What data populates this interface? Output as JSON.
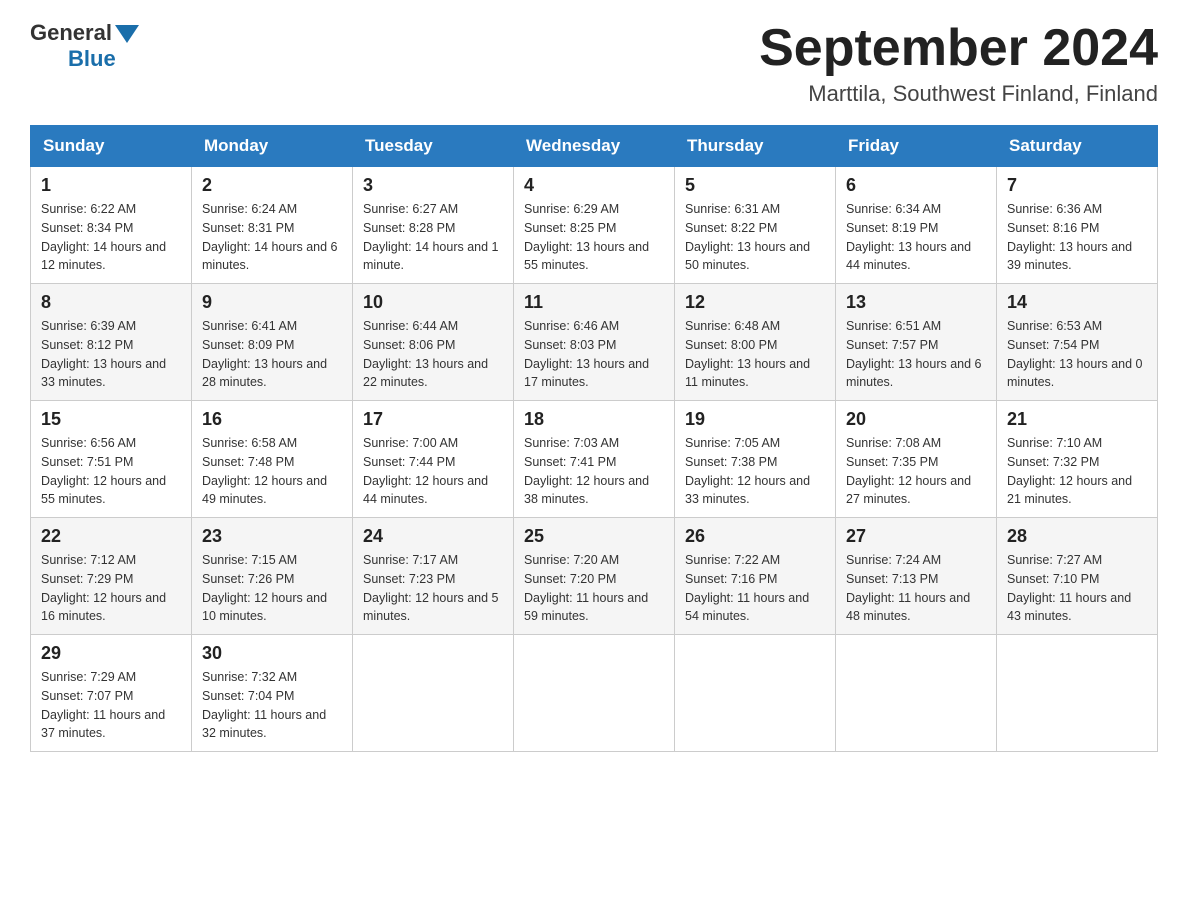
{
  "header": {
    "logo_general": "General",
    "logo_blue": "Blue",
    "month_year": "September 2024",
    "location": "Marttila, Southwest Finland, Finland"
  },
  "days_of_week": [
    "Sunday",
    "Monday",
    "Tuesday",
    "Wednesday",
    "Thursday",
    "Friday",
    "Saturday"
  ],
  "weeks": [
    [
      {
        "date": "1",
        "sunrise": "6:22 AM",
        "sunset": "8:34 PM",
        "daylight": "14 hours and 12 minutes."
      },
      {
        "date": "2",
        "sunrise": "6:24 AM",
        "sunset": "8:31 PM",
        "daylight": "14 hours and 6 minutes."
      },
      {
        "date": "3",
        "sunrise": "6:27 AM",
        "sunset": "8:28 PM",
        "daylight": "14 hours and 1 minute."
      },
      {
        "date": "4",
        "sunrise": "6:29 AM",
        "sunset": "8:25 PM",
        "daylight": "13 hours and 55 minutes."
      },
      {
        "date": "5",
        "sunrise": "6:31 AM",
        "sunset": "8:22 PM",
        "daylight": "13 hours and 50 minutes."
      },
      {
        "date": "6",
        "sunrise": "6:34 AM",
        "sunset": "8:19 PM",
        "daylight": "13 hours and 44 minutes."
      },
      {
        "date": "7",
        "sunrise": "6:36 AM",
        "sunset": "8:16 PM",
        "daylight": "13 hours and 39 minutes."
      }
    ],
    [
      {
        "date": "8",
        "sunrise": "6:39 AM",
        "sunset": "8:12 PM",
        "daylight": "13 hours and 33 minutes."
      },
      {
        "date": "9",
        "sunrise": "6:41 AM",
        "sunset": "8:09 PM",
        "daylight": "13 hours and 28 minutes."
      },
      {
        "date": "10",
        "sunrise": "6:44 AM",
        "sunset": "8:06 PM",
        "daylight": "13 hours and 22 minutes."
      },
      {
        "date": "11",
        "sunrise": "6:46 AM",
        "sunset": "8:03 PM",
        "daylight": "13 hours and 17 minutes."
      },
      {
        "date": "12",
        "sunrise": "6:48 AM",
        "sunset": "8:00 PM",
        "daylight": "13 hours and 11 minutes."
      },
      {
        "date": "13",
        "sunrise": "6:51 AM",
        "sunset": "7:57 PM",
        "daylight": "13 hours and 6 minutes."
      },
      {
        "date": "14",
        "sunrise": "6:53 AM",
        "sunset": "7:54 PM",
        "daylight": "13 hours and 0 minutes."
      }
    ],
    [
      {
        "date": "15",
        "sunrise": "6:56 AM",
        "sunset": "7:51 PM",
        "daylight": "12 hours and 55 minutes."
      },
      {
        "date": "16",
        "sunrise": "6:58 AM",
        "sunset": "7:48 PM",
        "daylight": "12 hours and 49 minutes."
      },
      {
        "date": "17",
        "sunrise": "7:00 AM",
        "sunset": "7:44 PM",
        "daylight": "12 hours and 44 minutes."
      },
      {
        "date": "18",
        "sunrise": "7:03 AM",
        "sunset": "7:41 PM",
        "daylight": "12 hours and 38 minutes."
      },
      {
        "date": "19",
        "sunrise": "7:05 AM",
        "sunset": "7:38 PM",
        "daylight": "12 hours and 33 minutes."
      },
      {
        "date": "20",
        "sunrise": "7:08 AM",
        "sunset": "7:35 PM",
        "daylight": "12 hours and 27 minutes."
      },
      {
        "date": "21",
        "sunrise": "7:10 AM",
        "sunset": "7:32 PM",
        "daylight": "12 hours and 21 minutes."
      }
    ],
    [
      {
        "date": "22",
        "sunrise": "7:12 AM",
        "sunset": "7:29 PM",
        "daylight": "12 hours and 16 minutes."
      },
      {
        "date": "23",
        "sunrise": "7:15 AM",
        "sunset": "7:26 PM",
        "daylight": "12 hours and 10 minutes."
      },
      {
        "date": "24",
        "sunrise": "7:17 AM",
        "sunset": "7:23 PM",
        "daylight": "12 hours and 5 minutes."
      },
      {
        "date": "25",
        "sunrise": "7:20 AM",
        "sunset": "7:20 PM",
        "daylight": "11 hours and 59 minutes."
      },
      {
        "date": "26",
        "sunrise": "7:22 AM",
        "sunset": "7:16 PM",
        "daylight": "11 hours and 54 minutes."
      },
      {
        "date": "27",
        "sunrise": "7:24 AM",
        "sunset": "7:13 PM",
        "daylight": "11 hours and 48 minutes."
      },
      {
        "date": "28",
        "sunrise": "7:27 AM",
        "sunset": "7:10 PM",
        "daylight": "11 hours and 43 minutes."
      }
    ],
    [
      {
        "date": "29",
        "sunrise": "7:29 AM",
        "sunset": "7:07 PM",
        "daylight": "11 hours and 37 minutes."
      },
      {
        "date": "30",
        "sunrise": "7:32 AM",
        "sunset": "7:04 PM",
        "daylight": "11 hours and 32 minutes."
      },
      null,
      null,
      null,
      null,
      null
    ]
  ],
  "labels": {
    "sunrise": "Sunrise:",
    "sunset": "Sunset:",
    "daylight": "Daylight:"
  }
}
